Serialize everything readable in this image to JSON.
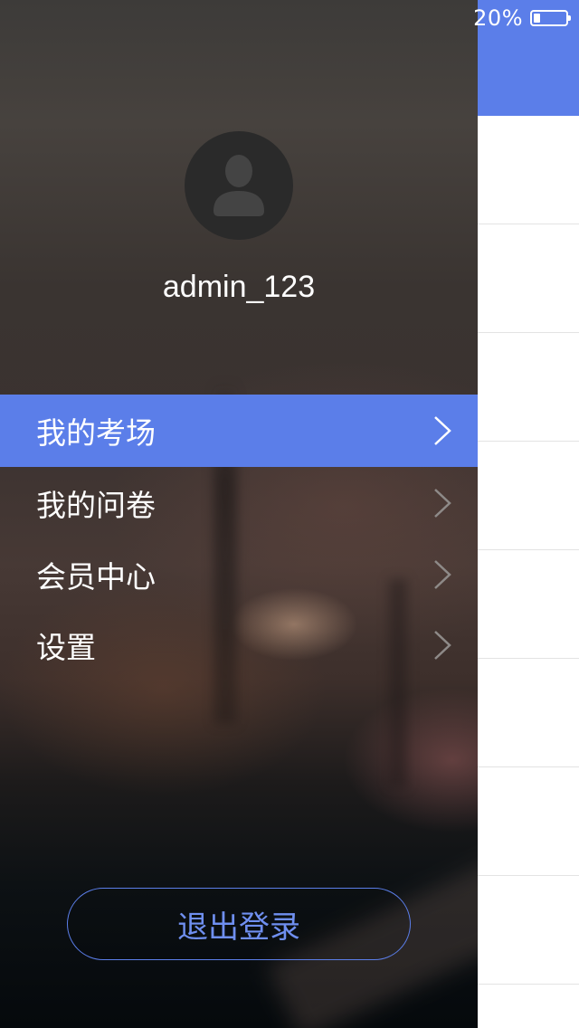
{
  "status_bar": {
    "battery_percent": "20%",
    "battery_level": 0.2
  },
  "drawer": {
    "username": "admin_123",
    "menu": [
      {
        "label": "我的考场",
        "active": true
      },
      {
        "label": "我的问卷",
        "active": false
      },
      {
        "label": "会员中心",
        "active": false
      },
      {
        "label": "设置",
        "active": false
      }
    ],
    "logout_label": "退出登录"
  },
  "colors": {
    "accent": "#5b7ee9",
    "logout_text": "#6f8ff0"
  },
  "icons": {
    "avatar": "user-silhouette-icon",
    "menu_arrow": "chevron-right-icon",
    "battery": "battery-icon"
  }
}
